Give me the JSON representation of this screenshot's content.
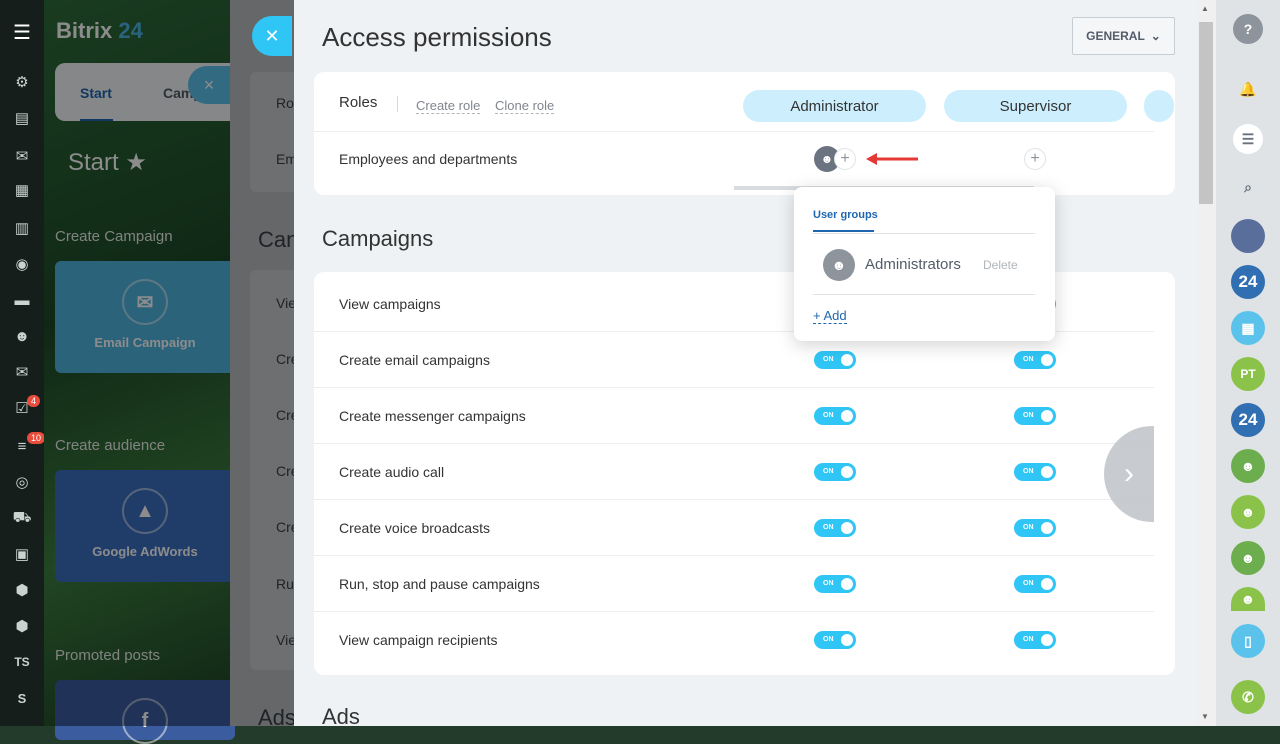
{
  "app": {
    "brand_name": "Bitrix",
    "brand_num": "24"
  },
  "leftnav": {
    "badge_tasks": "4",
    "badge_feed": "10",
    "label_ts": "TS",
    "label_s": "S"
  },
  "bg": {
    "tab_start": "Start",
    "tab_camp": "Camp",
    "start_title": "Start",
    "sec_create_campaign": "Create Campaign",
    "tile_email": "Email Campaign",
    "sec_create_audience": "Create audience",
    "tile_adwords": "Google AdWords",
    "sec_promoted": "Promoted posts",
    "behind_ro": "Ro",
    "behind_em": "Em",
    "behind_can": "Can",
    "behind_vie": "Vie",
    "behind_cre": "Cre",
    "behind_ru": "Ru",
    "behind_ads": "Ads"
  },
  "slider": {
    "title": "Access permissions",
    "general_btn": "GENERAL",
    "roles_label": "Roles",
    "create_role": "Create role",
    "clone_role": "Clone role",
    "roles": [
      "Administrator",
      "Supervisor"
    ],
    "employees_label": "Employees and departments",
    "campaigns_title": "Campaigns",
    "ads_title": "Ads",
    "toggle_on": "ON",
    "permissions": [
      "View campaigns",
      "Create email campaigns",
      "Create messenger campaigns",
      "Create audio call",
      "Create voice broadcasts",
      "Run, stop and pause campaigns",
      "View campaign recipients"
    ]
  },
  "popup": {
    "tab_user_groups": "User groups",
    "group_name": "Administrators",
    "delete_label": "Delete",
    "add_label": "+ Add"
  },
  "rightbar": {
    "pt_initials": "PT",
    "num24": "24"
  },
  "colors": {
    "accent": "#2fc6f6",
    "link": "#2067b0",
    "pill": "#cdeffd"
  }
}
